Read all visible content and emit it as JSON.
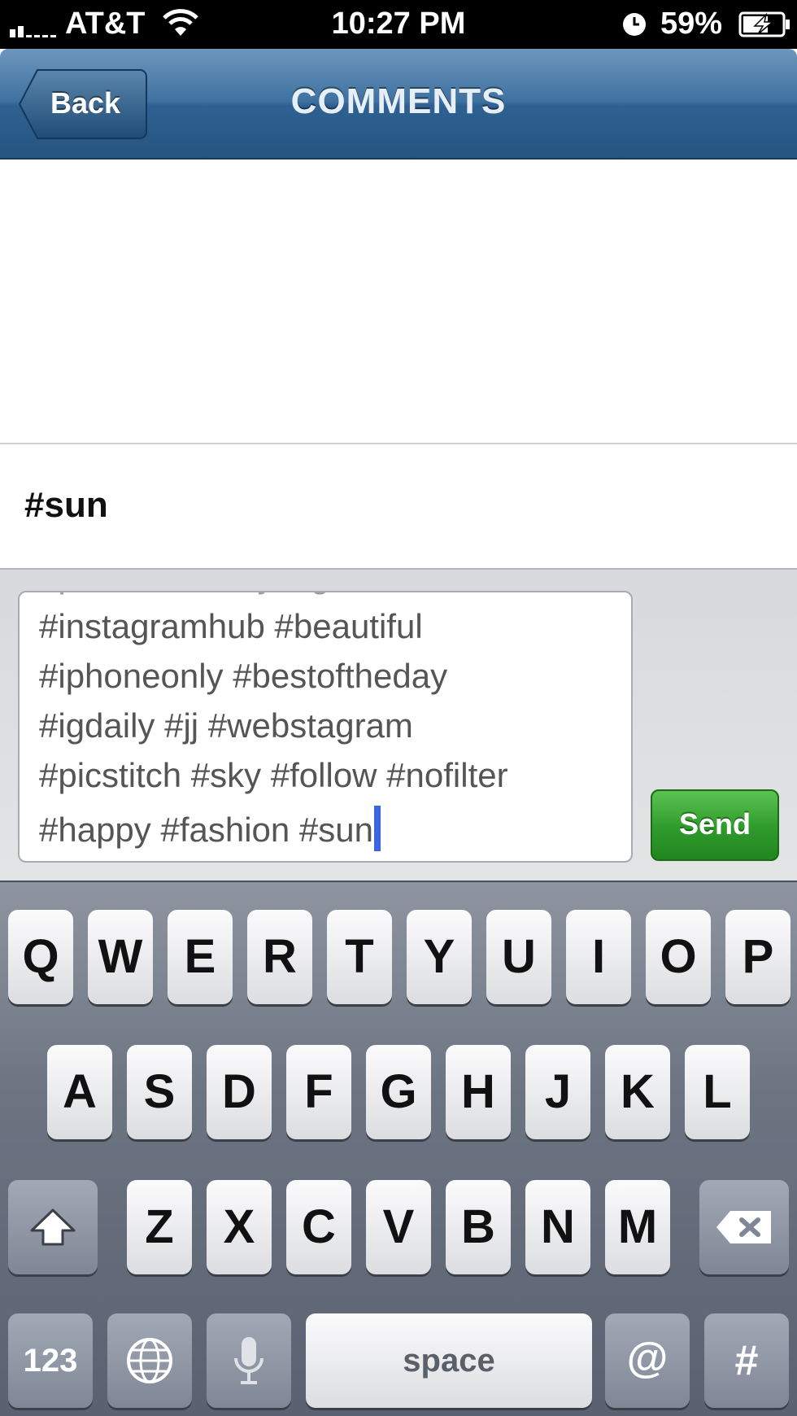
{
  "status_bar": {
    "carrier": "AT&T",
    "time": "10:27 PM",
    "battery_percent": "59%",
    "signal_icon": "signal-bars-icon",
    "wifi_icon": "wifi-icon",
    "lock_icon": "clock-icon",
    "battery_icon": "battery-charging-icon"
  },
  "nav": {
    "back_label": "Back",
    "title": "COMMENTS"
  },
  "comment": {
    "text": "#sun"
  },
  "composer": {
    "lines": [
      "#instagramhub #beautiful",
      "#iphoneonly #bestoftheday",
      "#igdaily #jj #webstagram",
      "#picstitch #sky #follow #nofilter",
      "#happy #fashion #sun"
    ],
    "send_label": "Send"
  },
  "keyboard": {
    "row1": [
      "Q",
      "W",
      "E",
      "R",
      "T",
      "Y",
      "U",
      "I",
      "O",
      "P"
    ],
    "row2": [
      "A",
      "S",
      "D",
      "F",
      "G",
      "H",
      "J",
      "K",
      "L"
    ],
    "row3": [
      "Z",
      "X",
      "C",
      "V",
      "B",
      "N",
      "M"
    ],
    "numbers_label": "123",
    "space_label": "space",
    "at_label": "@",
    "hash_label": "#"
  },
  "colors": {
    "nav_blue": "#2e6192",
    "send_green": "#2e9a2c",
    "cursor_blue": "#3a67e0"
  }
}
